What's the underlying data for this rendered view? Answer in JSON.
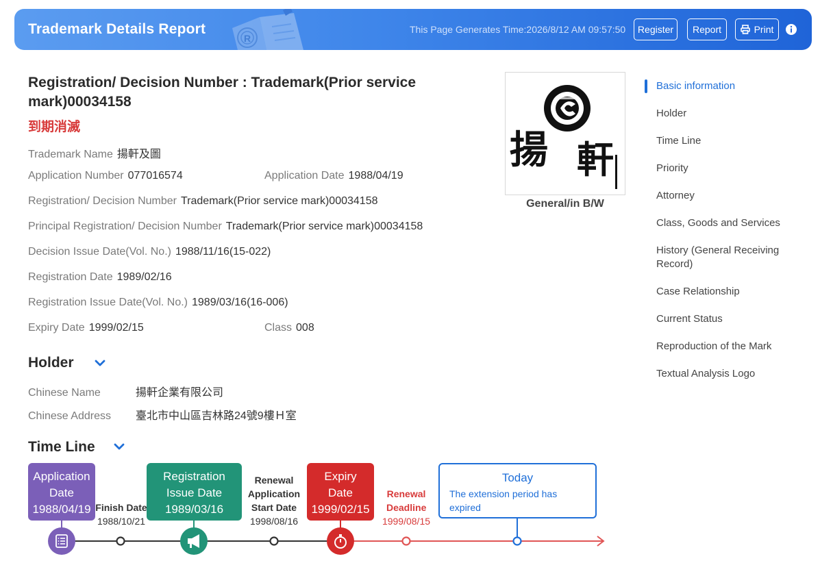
{
  "header": {
    "title": "Trademark Details Report",
    "generate_time": "This Page Generates Time:2026/8/12 AM 09:57:50",
    "register_label": "Register",
    "report_label": "Report",
    "print_label": "Print",
    "illustration_letter": "R"
  },
  "main": {
    "title": "Registration/ Decision Number : Trademark(Prior service mark)00034158",
    "status": "到期消滅",
    "fields": {
      "trademark_name": {
        "label": "Trademark Name",
        "value": "揚軒及圖"
      },
      "application_number": {
        "label": "Application Number",
        "value": "077016574"
      },
      "application_date": {
        "label": "Application Date",
        "value": "1988/04/19"
      },
      "registration_number": {
        "label": "Registration/ Decision Number",
        "value": "Trademark(Prior service mark)00034158"
      },
      "principal_registration": {
        "label": "Principal Registration/ Decision Number",
        "value": "Trademark(Prior service mark)00034158"
      },
      "decision_issue_date": {
        "label": "Decision Issue Date(Vol. No.)",
        "value": "1988/11/16(15-022)"
      },
      "registration_date": {
        "label": "Registration Date",
        "value": "1989/02/16"
      },
      "registration_issue_date": {
        "label": "Registration Issue Date(Vol. No.)",
        "value": "1989/03/16(16-006)"
      },
      "expiry_date": {
        "label": "Expiry Date",
        "value": "1999/02/15"
      },
      "class": {
        "label": "Class",
        "value": "008"
      }
    }
  },
  "mark": {
    "caption": "General/in B/W",
    "char_left": "揚",
    "char_right": "軒"
  },
  "holder": {
    "heading": "Holder",
    "chinese_name": {
      "label": "Chinese Name",
      "value": "揚軒企業有限公司"
    },
    "chinese_address": {
      "label": "Chinese Address",
      "value": "臺北市中山區吉林路24號9樓Ｈ室"
    }
  },
  "timeline": {
    "heading": "Time Line",
    "application": {
      "title": "Application Date",
      "date": "1988/04/19"
    },
    "finish": {
      "title": "Finish Date",
      "date": "1988/10/21"
    },
    "registration_issue": {
      "title": "Registration Issue Date",
      "date": "1989/03/16"
    },
    "renewal_start": {
      "title": "Renewal Application Start Date",
      "date": "1998/08/16"
    },
    "expiry": {
      "title": "Expiry Date",
      "date": "1999/02/15"
    },
    "renewal_deadline": {
      "title": "Renewal Deadline",
      "date": "1999/08/15"
    },
    "today": {
      "title": "Today",
      "desc": "The extension period has expired"
    }
  },
  "nav": {
    "items": [
      "Basic information",
      "Holder",
      "Time Line",
      "Priority",
      "Attorney",
      "Class, Goods and Services",
      "History (General Receiving Record)",
      "Case Relationship",
      "Current Status",
      "Reproduction of the Mark",
      "Textual Analysis Logo"
    ]
  },
  "colors": {
    "header_start": "#5b9cf0",
    "header_end": "#1f64d8",
    "accent_blue": "#1f6fd8",
    "status_red": "#d83b3b",
    "application_purple": "#7b5fb8",
    "registration_green": "#229478",
    "expiry_red": "#d42b2b"
  }
}
